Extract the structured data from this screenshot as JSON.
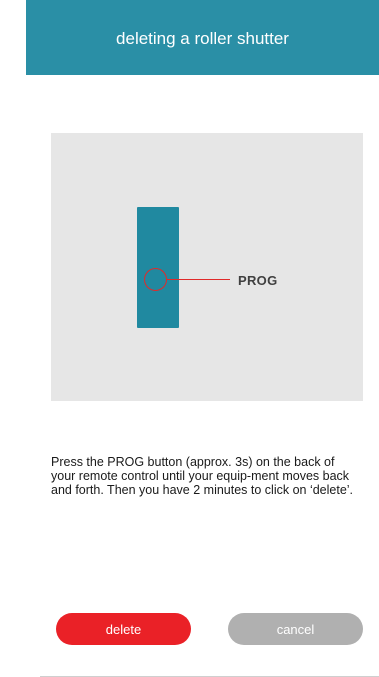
{
  "header": {
    "title": "deleting a roller shutter"
  },
  "illustration": {
    "prog_label": "PROG"
  },
  "instructions": {
    "text": "Press the PROG button (approx. 3s) on the back of your remote control until your equip-ment moves back and forth. Then you have 2 minutes to click on ‘delete’."
  },
  "buttons": {
    "delete_label": "delete",
    "cancel_label": "cancel"
  },
  "colors": {
    "header_bg": "#2a8fa6",
    "remote": "#2089a0",
    "prog_marker": "#e02a2a",
    "delete_button": "#ea2127",
    "cancel_button": "#b0b0b0",
    "illustration_bg": "#e6e6e6"
  }
}
